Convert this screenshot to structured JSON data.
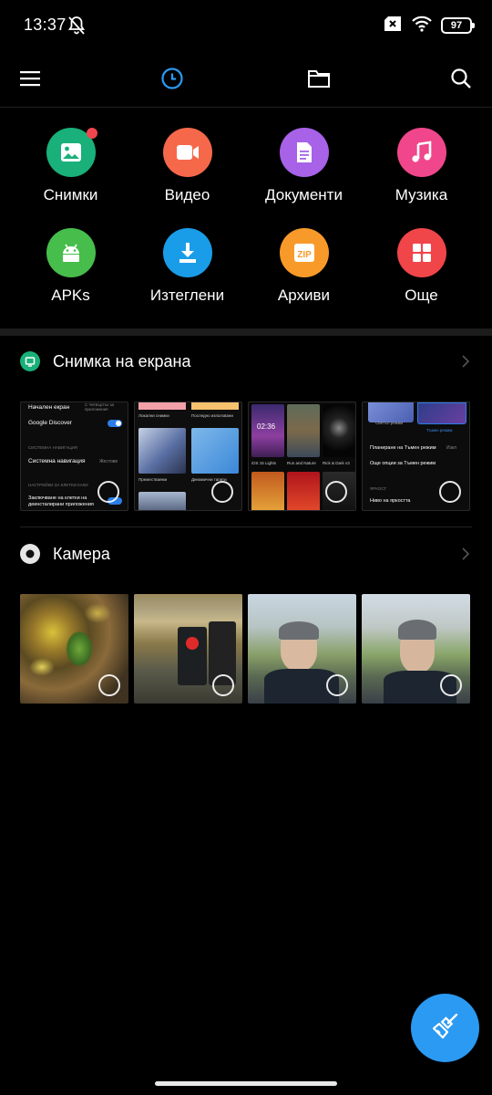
{
  "status_bar": {
    "time": "13:37",
    "battery": "97"
  },
  "toolbar": {
    "menu_icon": "menu-icon",
    "recent_icon": "clock-icon",
    "folder_icon": "folder-icon",
    "search_icon": "search-icon",
    "active_color": "#2b9af3"
  },
  "categories": [
    {
      "label": "Снимки",
      "icon": "image-icon",
      "color": "#19b07a"
    },
    {
      "label": "Видео",
      "icon": "video-icon",
      "color": "#f6684a"
    },
    {
      "label": "Документи",
      "icon": "document-icon",
      "color": "#a762e8"
    },
    {
      "label": "Музика",
      "icon": "music-icon",
      "color": "#f0468b"
    },
    {
      "label": "APKs",
      "icon": "android-icon",
      "color": "#47bd4b"
    },
    {
      "label": "Изтеглени",
      "icon": "download-icon",
      "color": "#1a9de8"
    },
    {
      "label": "Архиви",
      "icon": "zip-icon",
      "color": "#f89a2a"
    },
    {
      "label": "Още",
      "icon": "grid-icon",
      "color": "#f04549"
    }
  ],
  "sections": {
    "screenshots": {
      "title": "Снимка на екрана",
      "shot1": {
        "line1": "Начален екран",
        "line1_right": "С Четвъртък за приложения",
        "line2": "Google Discover",
        "line3": "СИСТЕМНА НАВИГАЦИЯ",
        "line4": "Системна навигация",
        "line4_right": "Жестове",
        "line5": "НАСТРОЙКИ ЗА КЛЕТКИ КАКИ",
        "line6": "Заключване на клетки на деинсталирани приложения"
      },
      "shot2": {
        "label1": "Локални снимки",
        "label2": "Последно използвани",
        "label3": "Преместваеми",
        "label4": "Динамични тапети"
      },
      "shot3": {
        "time": "02:36",
        "label1": "iOS 15 Lights",
        "label2": "Run and Nature",
        "label3": "Rick & Dark v3"
      },
      "shot4": {
        "label1": "Светъл режим",
        "label2": "Тъмен режим",
        "line1": "Планиране на Тъмен режим",
        "line1_right": "Изкл",
        "line2": "Още опции за Тъмен режим",
        "line3": "ЯРКОСТ",
        "line4": "Ниво на яркостта"
      }
    },
    "camera": {
      "title": "Камера"
    }
  },
  "fab": {
    "icon": "broom-icon",
    "color": "#2b9af3"
  }
}
